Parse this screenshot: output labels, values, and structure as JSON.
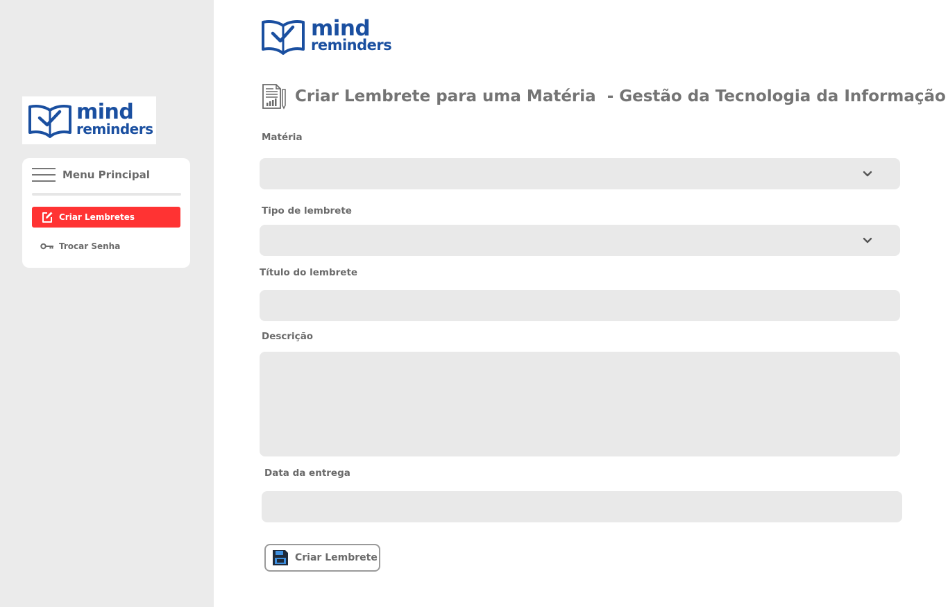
{
  "brand": {
    "name_line1": "mind",
    "name_line2": "reminders",
    "color": "#1a4fa0"
  },
  "sidebar": {
    "menu_title": "Menu Principal",
    "items": [
      {
        "label": "Criar Lembretes",
        "icon": "edit-icon",
        "active": true
      },
      {
        "label": "Trocar Senha",
        "icon": "key-icon",
        "active": false
      }
    ]
  },
  "header": {
    "title": "Criar Lembrete para uma Matéria  - Gestão da Tecnologia da Informação",
    "icon": "report-document-icon"
  },
  "form": {
    "materia": {
      "label": "Matéria",
      "value": ""
    },
    "tipo": {
      "label": "Tipo de lembrete",
      "value": ""
    },
    "titulo": {
      "label": "Título do lembrete",
      "value": ""
    },
    "descricao": {
      "label": "Descrição",
      "value": ""
    },
    "data": {
      "label": "Data da entrega",
      "value": ""
    },
    "submit_label": "Criar Lembrete"
  },
  "colors": {
    "accent": "#ff3333",
    "sidebar_bg": "#ebebeb",
    "field_bg": "#e9e9e9",
    "text_gray": "#6a6a6a"
  }
}
